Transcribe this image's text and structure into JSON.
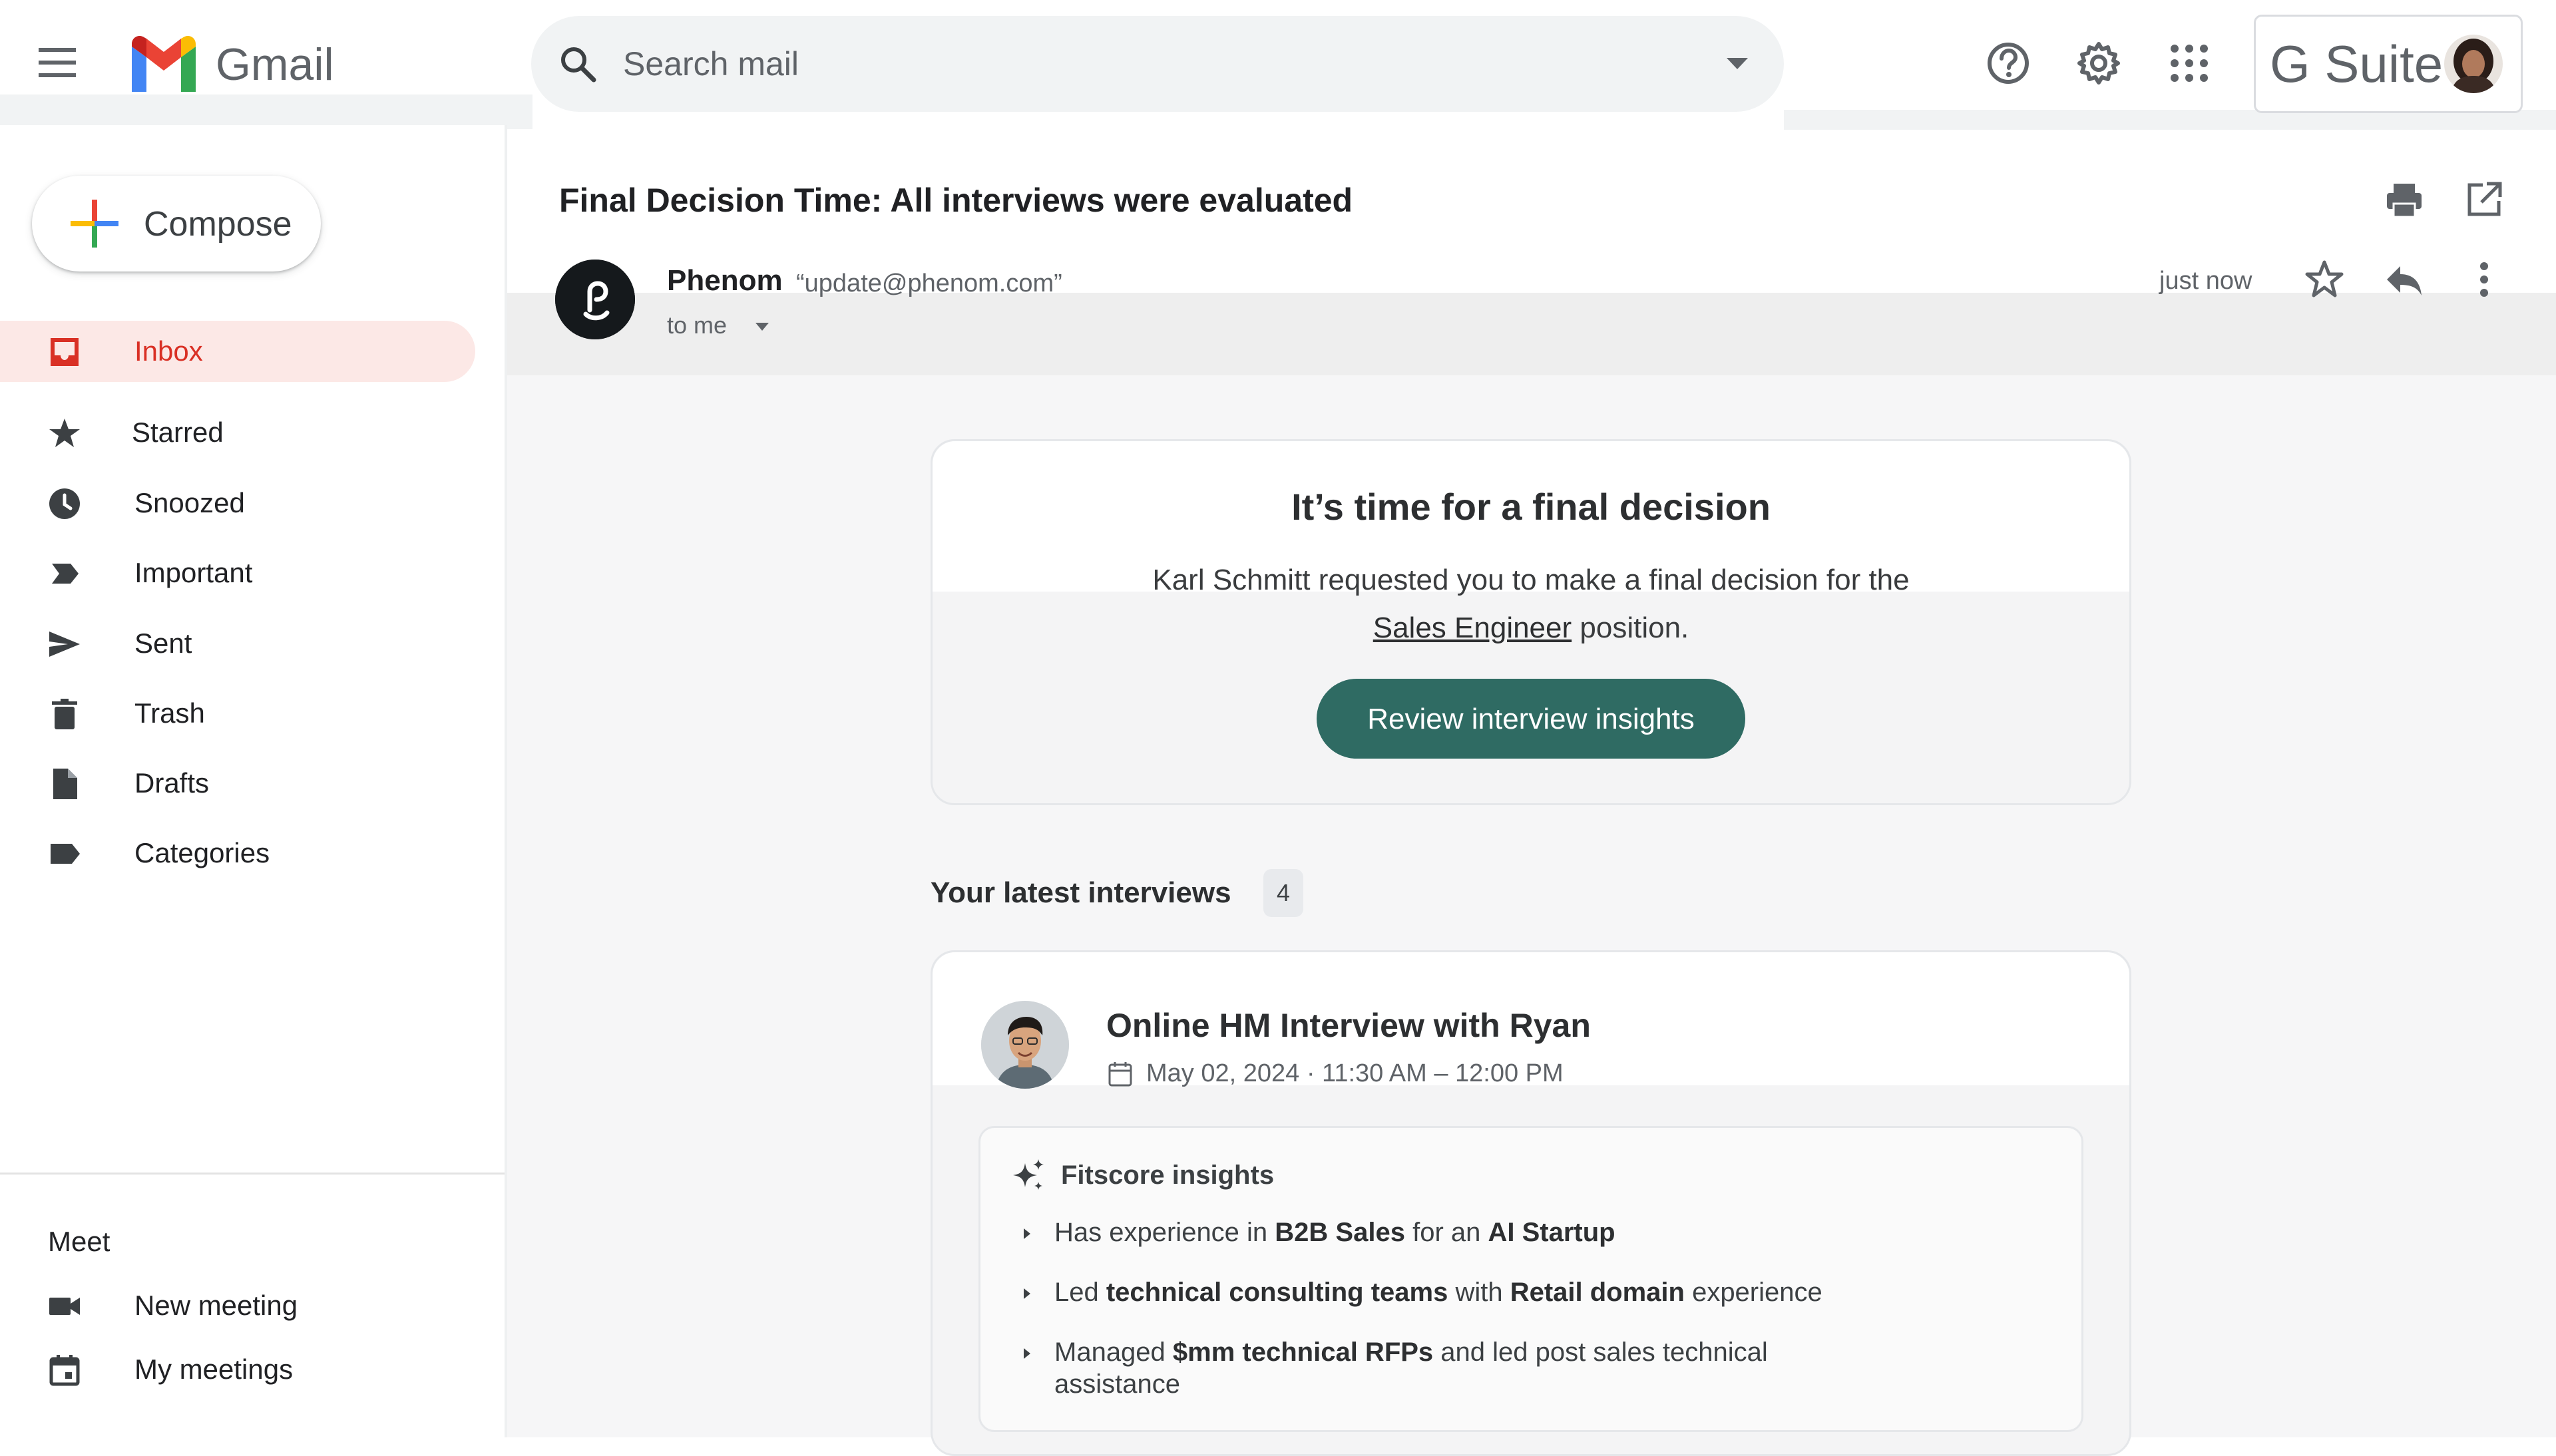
{
  "app": {
    "brand": "Gmail",
    "gsuite_label": "G Suite"
  },
  "search": {
    "placeholder": "Search mail"
  },
  "sidebar": {
    "compose_label": "Compose",
    "items": [
      {
        "label": "Inbox",
        "icon": "inbox-icon",
        "active": true
      },
      {
        "label": "Starred",
        "icon": "star-icon"
      },
      {
        "label": "Snoozed",
        "icon": "clock-icon"
      },
      {
        "label": "Important",
        "icon": "important-icon"
      },
      {
        "label": "Sent",
        "icon": "send-icon"
      },
      {
        "label": "Trash",
        "icon": "trash-icon"
      },
      {
        "label": "Drafts",
        "icon": "draft-icon"
      },
      {
        "label": "Categories",
        "icon": "label-icon"
      }
    ],
    "meet": {
      "title": "Meet",
      "items": [
        {
          "label": "New meeting",
          "icon": "video-icon"
        },
        {
          "label": "My meetings",
          "icon": "calendar-icon"
        }
      ]
    }
  },
  "email": {
    "subject": "Final Decision Time: All interviews were evaluated",
    "sender_name": "Phenom",
    "sender_email": "“update@phenom.com”",
    "to": "to me",
    "time": "just now",
    "card": {
      "title": "It’s time for a final decision",
      "line1": "Karl Schmitt requested you  to make a final decision for the",
      "position_link": "Sales Engineer",
      "line2_suffix": " position.",
      "button": "Review interview insights"
    },
    "latest": {
      "title": "Your latest interviews",
      "count": "4"
    },
    "interview": {
      "title": "Online HM Interview with Ryan",
      "date": "May 02, 2024 · 11:30 AM – 12:00 PM",
      "fitscore_title": "Fitscore insights",
      "insights": [
        {
          "p1": "Has experience in ",
          "b1": "B2B Sales",
          "p2": " for an ",
          "b2": "AI Startup",
          "p3": ""
        },
        {
          "p1": "Led ",
          "b1": "technical consulting teams",
          "p2": " with ",
          "b2": "Retail domain",
          "p3": " experience"
        },
        {
          "p1": "Managed ",
          "b1": "$mm technical RFPs",
          "p2": " and led post sales technical assistance",
          "b2": "",
          "p3": ""
        }
      ]
    }
  },
  "colors": {
    "gmail_red": "#d93025",
    "active_bg": "#fce8e6",
    "button_green": "#2f6b63"
  }
}
